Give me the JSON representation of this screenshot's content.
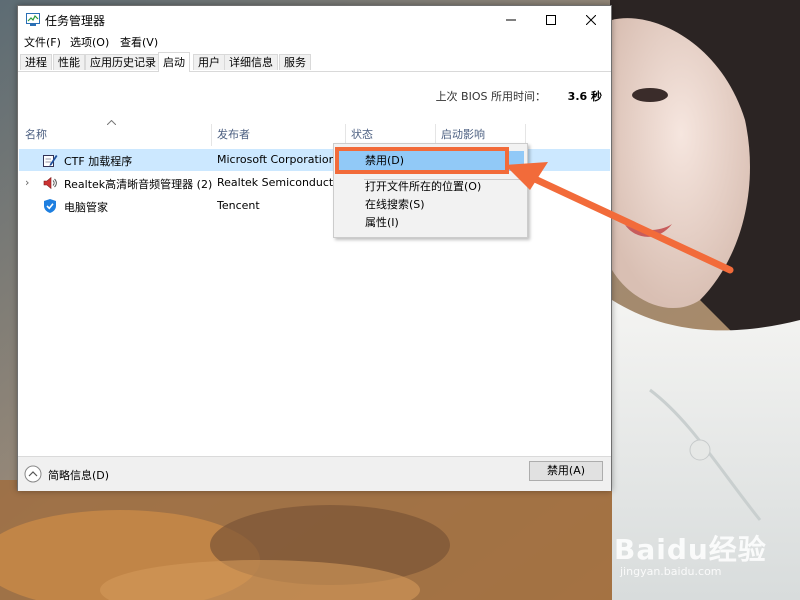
{
  "window": {
    "title": "任务管理器",
    "controls": {
      "minimize": "minimize-icon",
      "maximize": "maximize-icon",
      "close": "close-icon"
    }
  },
  "menu": [
    "文件(F)",
    "选项(O)",
    "查看(V)"
  ],
  "tabs": [
    {
      "label": "进程"
    },
    {
      "label": "性能"
    },
    {
      "label": "应用历史记录"
    },
    {
      "label": "启动",
      "active": true
    },
    {
      "label": "用户"
    },
    {
      "label": "详细信息"
    },
    {
      "label": "服务"
    }
  ],
  "bios": {
    "label": "上次 BIOS 所用时间：",
    "value": "3.6 秒"
  },
  "table": {
    "columns": [
      "名称",
      "发布者",
      "状态",
      "启动影响"
    ],
    "rows": [
      {
        "name": "CTF 加载程序",
        "publisher": "Microsoft Corporation",
        "icon": "pen-icon",
        "selected": true,
        "expandable": false
      },
      {
        "name": "Realtek高清晰音频管理器 (2)",
        "publisher": "Realtek Semiconductor",
        "icon": "speaker-icon",
        "selected": false,
        "expandable": true
      },
      {
        "name": "电脑管家",
        "publisher": "Tencent",
        "icon": "shield-icon",
        "selected": false,
        "expandable": false
      }
    ]
  },
  "context_menu": {
    "items": [
      "禁用(D)",
      "打开文件所在的位置(O)",
      "在线搜索(S)",
      "属性(I)"
    ]
  },
  "footer": {
    "collapse_label": "简略信息(D)",
    "disable_button": "禁用(A)"
  },
  "watermark": {
    "brand": "Baidu经验",
    "url": "jingyan.baidu.com"
  },
  "colors": {
    "selection": "#cce8ff",
    "menu_highlight": "#91c9f7",
    "annotation": "#f26b3a",
    "header_text": "#4d6082"
  }
}
